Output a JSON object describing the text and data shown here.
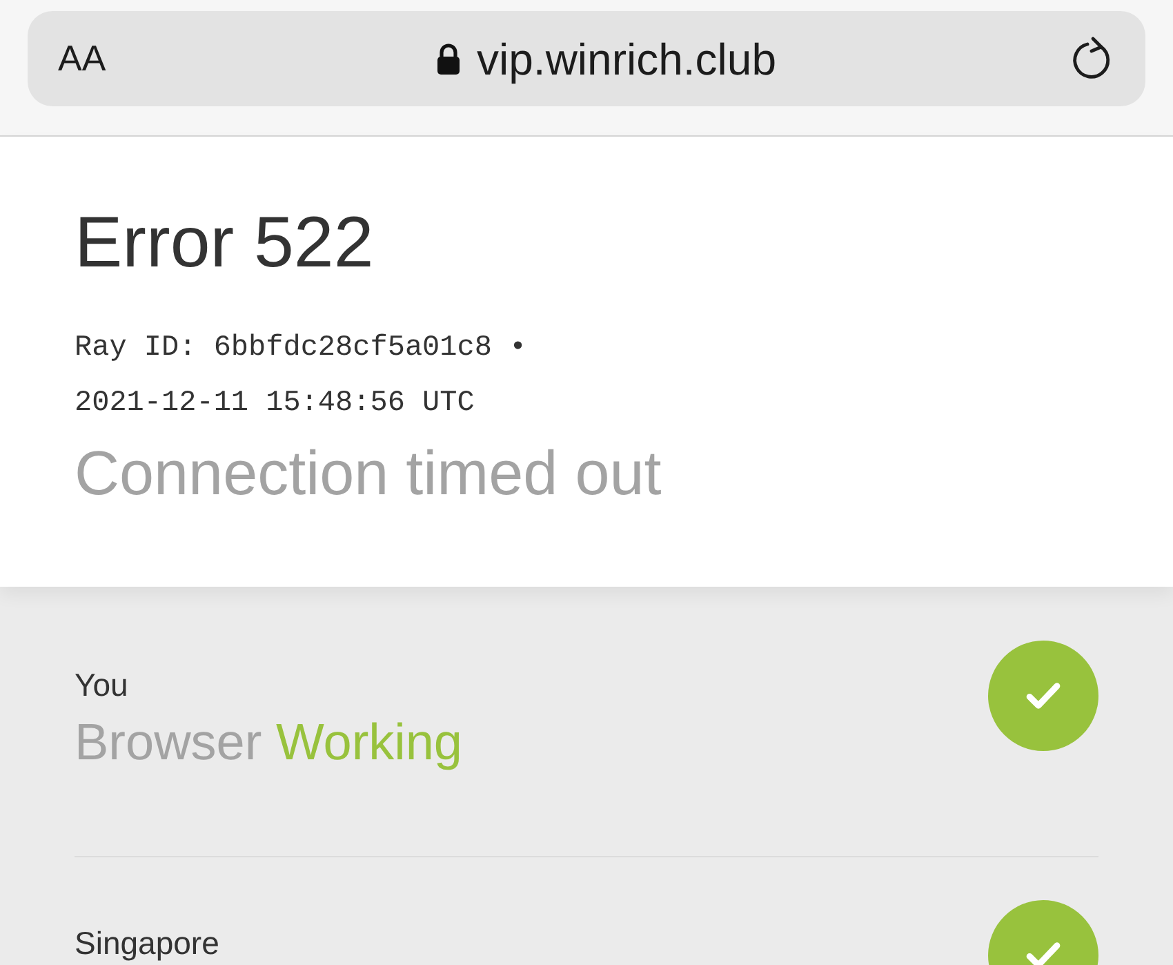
{
  "browser": {
    "text_size_button": "AA",
    "url": "vip.winrich.club"
  },
  "error": {
    "title": "Error 522",
    "ray_id": "Ray ID: 6bbfdc28cf5a01c8 •",
    "timestamp": "2021-12-11 15:48:56 UTC",
    "message": "Connection timed out"
  },
  "nodes": [
    {
      "location": "You",
      "name": "Browser",
      "status_text": "Working",
      "working": true
    },
    {
      "location": "Singapore",
      "working": true
    }
  ]
}
